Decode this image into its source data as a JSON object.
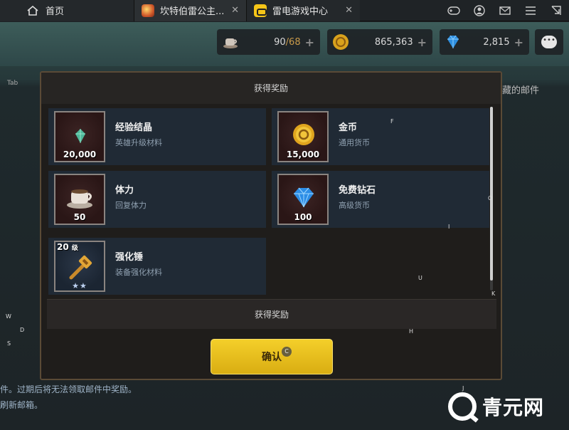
{
  "browser": {
    "home_tab": "首页",
    "game_tab": "坎特伯雷公主...",
    "center_tab": "雷电游戏中心",
    "close_glyph": "✕"
  },
  "resources": {
    "stamina": {
      "current": "90",
      "max": "/68"
    },
    "gold": "865,363",
    "diamond": "2,815",
    "plus": "+"
  },
  "background": {
    "side_tab": "Tab",
    "mail_fragment": "藏的邮件",
    "notice_line1": "件。过期后将无法领取邮件中奖励。",
    "notice_line2": "刷新邮箱。"
  },
  "keys": {
    "F": "F",
    "O": "O",
    "I": "I",
    "U": "U",
    "K": "K",
    "H": "H",
    "W": "W",
    "D": "D",
    "S": "S",
    "J": "J",
    "C": "C"
  },
  "modal": {
    "title": "获得奖励",
    "footer": "获得奖励",
    "confirm": "确认"
  },
  "rewards": [
    {
      "name": "经验结晶",
      "desc": "英雄升级材料",
      "qty": "20,000",
      "icon": "crystal-icon"
    },
    {
      "name": "金币",
      "desc": "通用货币",
      "qty": "15,000",
      "icon": "gold-coin-icon"
    },
    {
      "name": "体力",
      "desc": "回复体力",
      "qty": "50",
      "icon": "coffee-cup-icon"
    },
    {
      "name": "免费钻石",
      "desc": "高级货币",
      "qty": "100",
      "icon": "diamond-icon"
    },
    {
      "name": "强化锤",
      "desc": "装备强化材料",
      "level": "20",
      "level_unit": "级",
      "stars": "★★",
      "icon": "hammer-icon"
    }
  ],
  "watermark": "青元网"
}
